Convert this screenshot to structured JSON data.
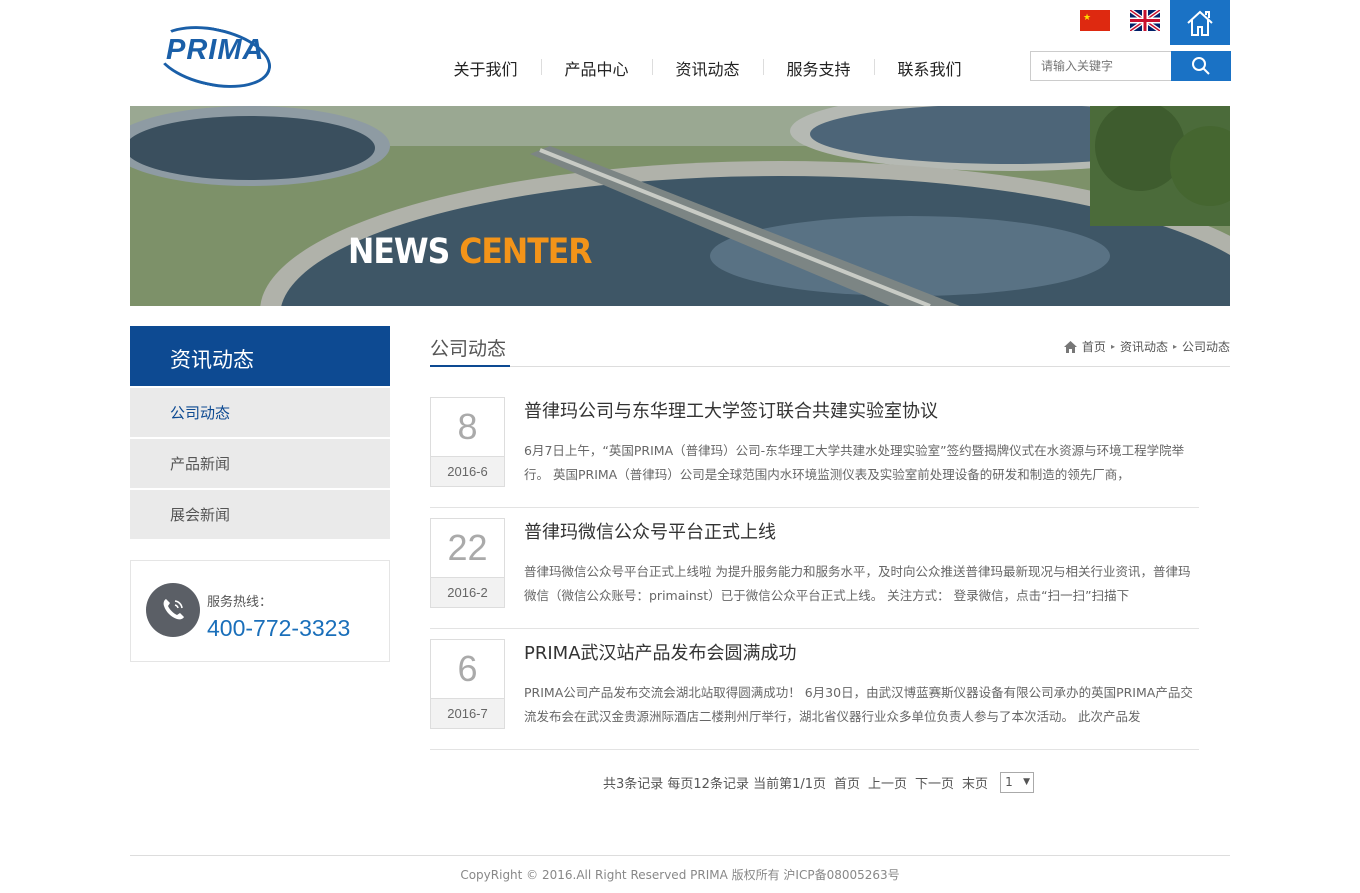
{
  "header": {
    "logo_text": "PRIMA",
    "nav": [
      "关于我们",
      "产品中心",
      "资讯动态",
      "服务支持",
      "联系我们"
    ],
    "search_placeholder": "请输入关键字"
  },
  "banner": {
    "text_white": "NEWS",
    "text_orange": "CENTER"
  },
  "sidebar": {
    "heading": "资讯动态",
    "items": [
      "公司动态",
      "产品新闻",
      "展会新闻"
    ],
    "hotline_label": "服务热线：",
    "hotline_number": "400-772-3323"
  },
  "content": {
    "title": "公司动态",
    "breadcrumb": [
      "首页",
      "资讯动态",
      "公司动态"
    ],
    "news": [
      {
        "day": "8",
        "ym": "2016-6",
        "title": "普律玛公司与东华理工大学签订联合共建实验室协议",
        "desc": "6月7日上午，“英国PRIMA（普律玛）公司-东华理工大学共建水处理实验室”签约暨揭牌仪式在水资源与环境工程学院举行。 英国PRIMA（普律玛）公司是全球范围内水环境监测仪表及实验室前处理设备的研发和制造的领先厂商，"
      },
      {
        "day": "22",
        "ym": "2016-2",
        "title": "普律玛微信公众号平台正式上线",
        "desc": "普律玛微信公众号平台正式上线啦 为提升服务能力和服务水平，及时向公众推送普律玛最新现况与相关行业资讯，普律玛微信（微信公众账号：primainst）已于微信公众平台正式上线。 关注方式： 登录微信，点击“扫一扫”扫描下"
      },
      {
        "day": "6",
        "ym": "2016-7",
        "title": "PRIMA武汉站产品发布会圆满成功",
        "desc": "PRIMA公司产品发布交流会湖北站取得圆满成功！ 6月30日，由武汉博蓝赛斯仪器设备有限公司承办的英国PRIMA产品交流发布会在武汉金贵源洲际酒店二楼荆州厅举行，湖北省仪器行业众多单位负责人参与了本次活动。 此次产品发"
      }
    ],
    "pager": {
      "summary": "共3条记录 每页12条记录 当前第1/1页",
      "first": "首页",
      "prev": "上一页",
      "next": "下一页",
      "last": "末页",
      "page_select": "1"
    }
  },
  "footer": {
    "text": "CopyRight © 2016.All Right Reserved PRIMA 版权所有 沪ICP备08005263号"
  },
  "colors": {
    "brand_blue": "#0d4a92",
    "accent_blue": "#1a72c5",
    "orange": "#f39419"
  }
}
